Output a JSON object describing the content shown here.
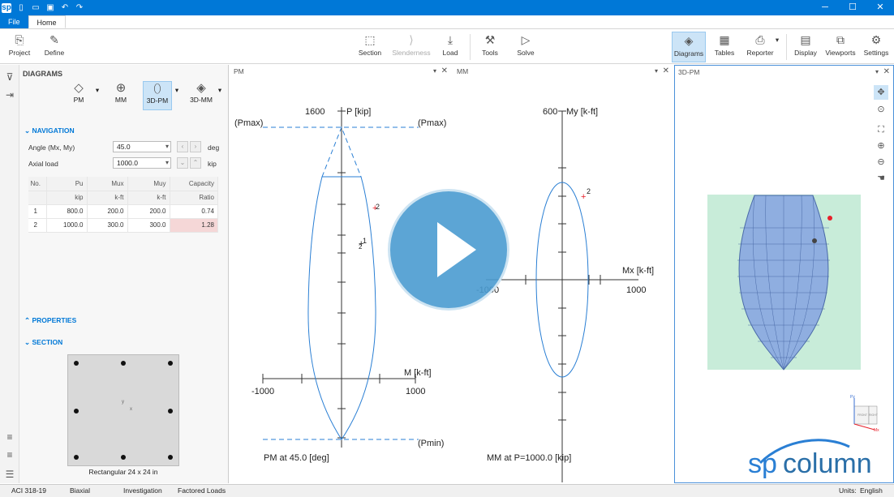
{
  "titlebar": {
    "logo": "sp"
  },
  "tabs": {
    "file": "File",
    "home": "Home"
  },
  "ribbon": {
    "project": "Project",
    "define": "Define",
    "section": "Section",
    "slenderness": "Slenderness",
    "load": "Load",
    "tools": "Tools",
    "solve": "Solve",
    "diagrams": "Diagrams",
    "tables": "Tables",
    "reporter": "Reporter",
    "display": "Display",
    "viewports": "Viewports",
    "settings": "Settings"
  },
  "panel": {
    "title": "DIAGRAMS",
    "diagram_types": [
      "PM",
      "MM",
      "3D-PM",
      "3D-MM"
    ],
    "navigation": {
      "title": "NAVIGATION",
      "angle_label": "Angle (Mx, My)",
      "angle_value": "45.0",
      "angle_unit": "deg",
      "axial_label": "Axial load",
      "axial_value": "1000.0",
      "axial_unit": "kip"
    },
    "table": {
      "headers": [
        "No.",
        "Pu",
        "Mux",
        "Muy",
        "Capacity"
      ],
      "units": [
        "",
        "kip",
        "k-ft",
        "k-ft",
        "Ratio"
      ],
      "rows": [
        [
          "1",
          "800.0",
          "200.0",
          "200.0",
          "0.74"
        ],
        [
          "2",
          "1000.0",
          "300.0",
          "300.0",
          "1.28"
        ]
      ]
    },
    "properties": "PROPERTIES",
    "section": "SECTION",
    "section_caption": "Rectangular 24 x 24 in",
    "section_axis_y": "y",
    "section_axis_x": "x"
  },
  "pm": {
    "header": "PM",
    "p_axis": "P [kip]",
    "p_tick": "1600",
    "pmax": "(Pmax)",
    "pmin": "(Pmin)",
    "m_axis": "M [k-ft]",
    "m_neg": "-1000",
    "m_pos": "1000",
    "pt1": "1",
    "pt2": "2",
    "caption": "PM at 45.0 [deg]"
  },
  "mm": {
    "header": "MM",
    "my_axis": "My [k-ft]",
    "my_tick": "600",
    "mx_axis": "Mx [k-ft]",
    "mx_neg": "-1000",
    "mx_pos": "1000",
    "pt2": "2",
    "caption": "MM at P=1000.0 [kip]"
  },
  "pm3d": {
    "header": "3D-PM",
    "axis_pz": "Pz",
    "axis_mx": "Mx",
    "face_front": "FRONT",
    "face_right": "RIGHT"
  },
  "brand": {
    "sp": "sp",
    "column": "column"
  },
  "status": {
    "code": "ACI 318-19",
    "mode": "Biaxial",
    "run": "Investigation",
    "loads": "Factored Loads",
    "units_label": "Units:",
    "units_value": "English"
  },
  "colors": {
    "accent": "#0078d7",
    "curve": "#2a7fd4",
    "point_red": "#e8202a",
    "hull_bg": "#c8ecd9"
  }
}
